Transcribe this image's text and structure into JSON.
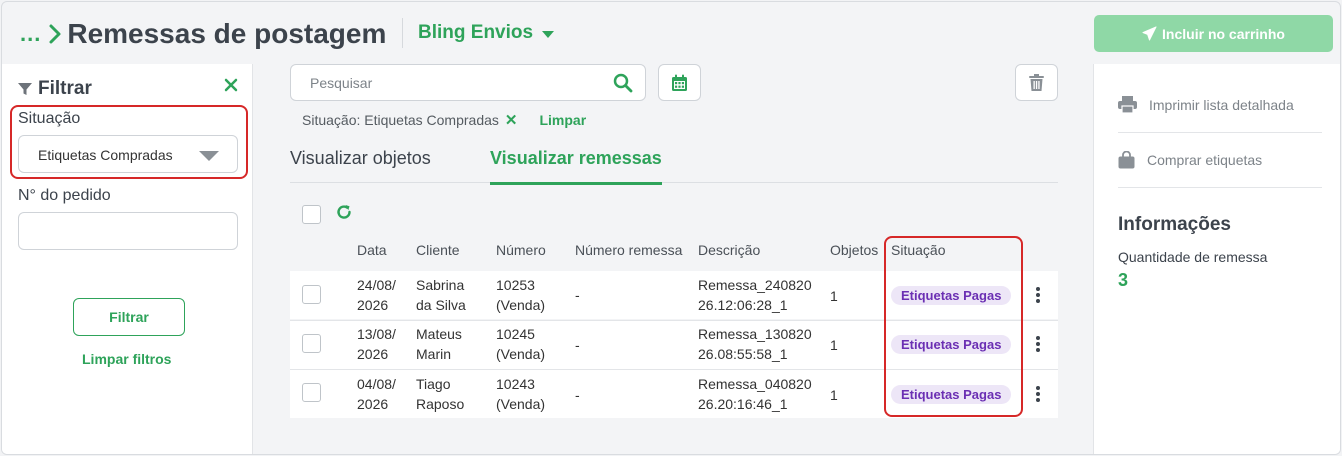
{
  "header": {
    "breadcrumb_dots": "...",
    "title": "Remessas de postagem",
    "integration": "Bling Envios",
    "cart_button": "Incluir no carrinho"
  },
  "filter": {
    "title": "Filtrar",
    "situacao_label": "Situação",
    "situacao_value": "Etiquetas Compradas",
    "pedido_label": "N° do pedido",
    "pedido_value": "",
    "filter_button": "Filtrar",
    "clear_link": "Limpar filtros"
  },
  "search": {
    "placeholder": "Pesquisar"
  },
  "active_filter": {
    "text": "Situação: Etiquetas Compradas",
    "remove": "✕",
    "clear": "Limpar"
  },
  "tabs": [
    {
      "label": "Visualizar objetos",
      "active": false
    },
    {
      "label": "Visualizar remessas",
      "active": true
    }
  ],
  "table": {
    "columns": [
      "Data",
      "Cliente",
      "Número",
      "Número remessa",
      "Descrição",
      "Objetos",
      "Situação"
    ],
    "rows": [
      {
        "data1": "24/08/",
        "data2": "2026",
        "cliente1": "Sabrina",
        "cliente2": "da Silva",
        "numero1": "10253",
        "numero2": "(Venda)",
        "numero_remessa": "-",
        "desc1": "Remessa_240820",
        "desc2": "26.12:06:28_1",
        "objetos": "1",
        "situacao": "Etiquetas Pagas"
      },
      {
        "data1": "13/08/",
        "data2": "2026",
        "cliente1": "Mateus",
        "cliente2": "Marin",
        "numero1": "10245",
        "numero2": "(Venda)",
        "numero_remessa": "-",
        "desc1": "Remessa_130820",
        "desc2": "26.08:55:58_1",
        "objetos": "1",
        "situacao": "Etiquetas Pagas"
      },
      {
        "data1": "04/08/",
        "data2": "2026",
        "cliente1": "Tiago",
        "cliente2": "Raposo",
        "numero1": "10243",
        "numero2": "(Venda)",
        "numero_remessa": "-",
        "desc1": "Remessa_040820",
        "desc2": "26.20:16:46_1",
        "objetos": "1",
        "situacao": "Etiquetas Pagas"
      }
    ]
  },
  "side": {
    "print_label": "Imprimir lista detalhada",
    "buy_label": "Comprar etiquetas",
    "info_title": "Informações",
    "qty_label": "Quantidade de remessa",
    "qty_value": "3"
  },
  "colors": {
    "accent": "#2ea35a",
    "accent_disabled": "#8fd8a6",
    "badge_bg": "#ede6f7",
    "badge_text": "#6b2fb3",
    "highlight": "#d62828"
  },
  "icons": [
    "chevron-right-icon",
    "caret-down-icon",
    "paper-plane-icon",
    "filter-icon",
    "close-icon",
    "search-icon",
    "calendar-icon",
    "trash-icon",
    "refresh-icon",
    "kebab-icon",
    "printer-icon",
    "shopping-bag-icon"
  ]
}
